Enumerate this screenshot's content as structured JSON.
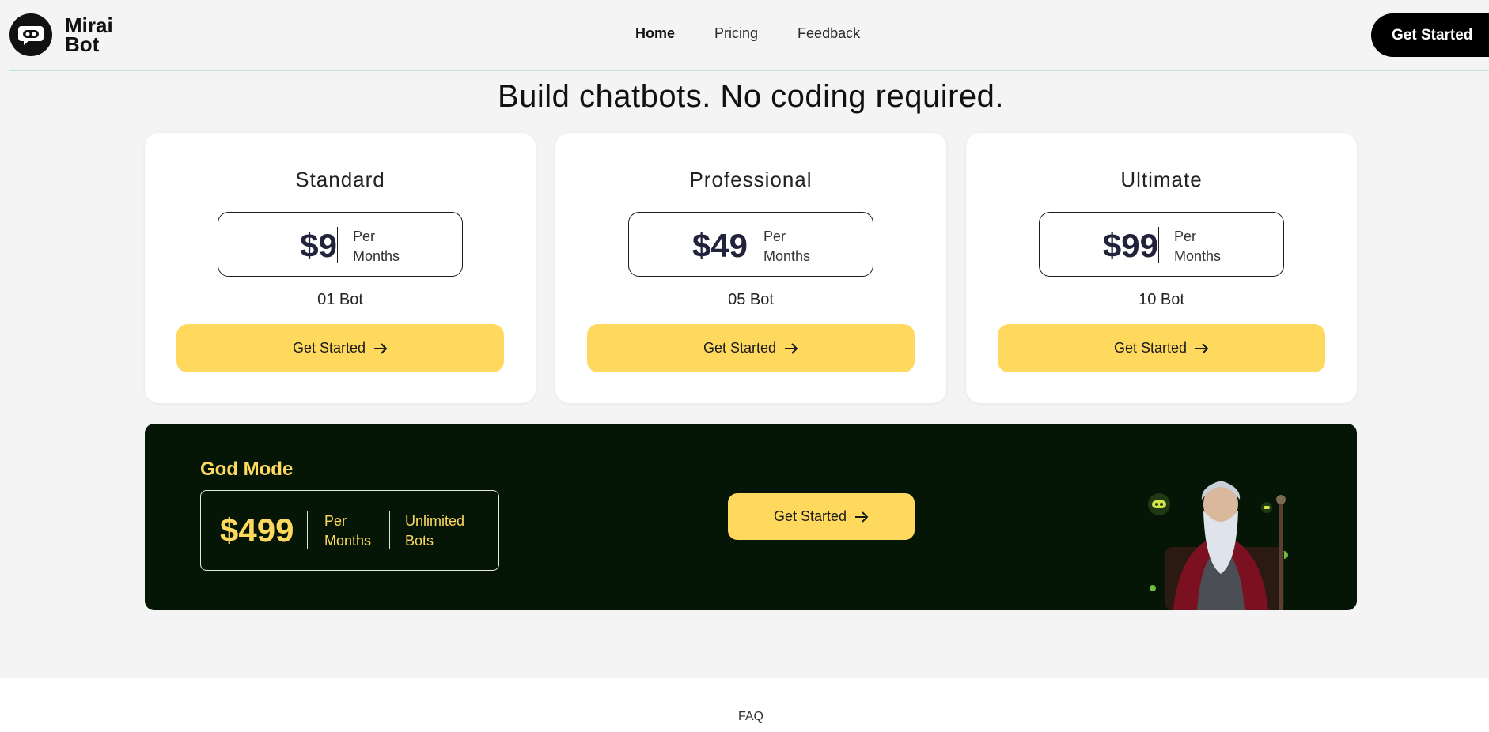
{
  "brand": {
    "name_line1": "Mirai",
    "name_line2": "Bot"
  },
  "nav": {
    "items": [
      "Home",
      "Pricing",
      "Feedback"
    ],
    "active": "Home"
  },
  "header": {
    "cta_label": "Get Started"
  },
  "headline": "Build chatbots. No coding required.",
  "plans": [
    {
      "name": "Standard",
      "price": "$9",
      "period_line1": "Per",
      "period_line2": "Months",
      "bots": "01 Bot",
      "cta": "Get Started"
    },
    {
      "name": "Professional",
      "price": "$49",
      "period_line1": "Per",
      "period_line2": "Months",
      "bots": "05 Bot",
      "cta": "Get Started"
    },
    {
      "name": "Ultimate",
      "price": "$99",
      "period_line1": "Per",
      "period_line2": "Months",
      "bots": "10 Bot",
      "cta": "Get Started"
    }
  ],
  "god_mode": {
    "title": "God Mode",
    "price": "$499",
    "period_line1": "Per",
    "period_line2": "Months",
    "bots_line1": "Unlimited",
    "bots_line2": "Bots",
    "cta": "Get Started"
  },
  "footer": {
    "faq_label": "FAQ"
  },
  "colors": {
    "accent": "#ffd95e",
    "dark_banner": "#051606",
    "background": "#f4f4f4"
  },
  "icons": {
    "logo": "robot-chat-icon",
    "cta_arrow": "arrow-right-icon",
    "banner_image": "wizard-illustration"
  }
}
